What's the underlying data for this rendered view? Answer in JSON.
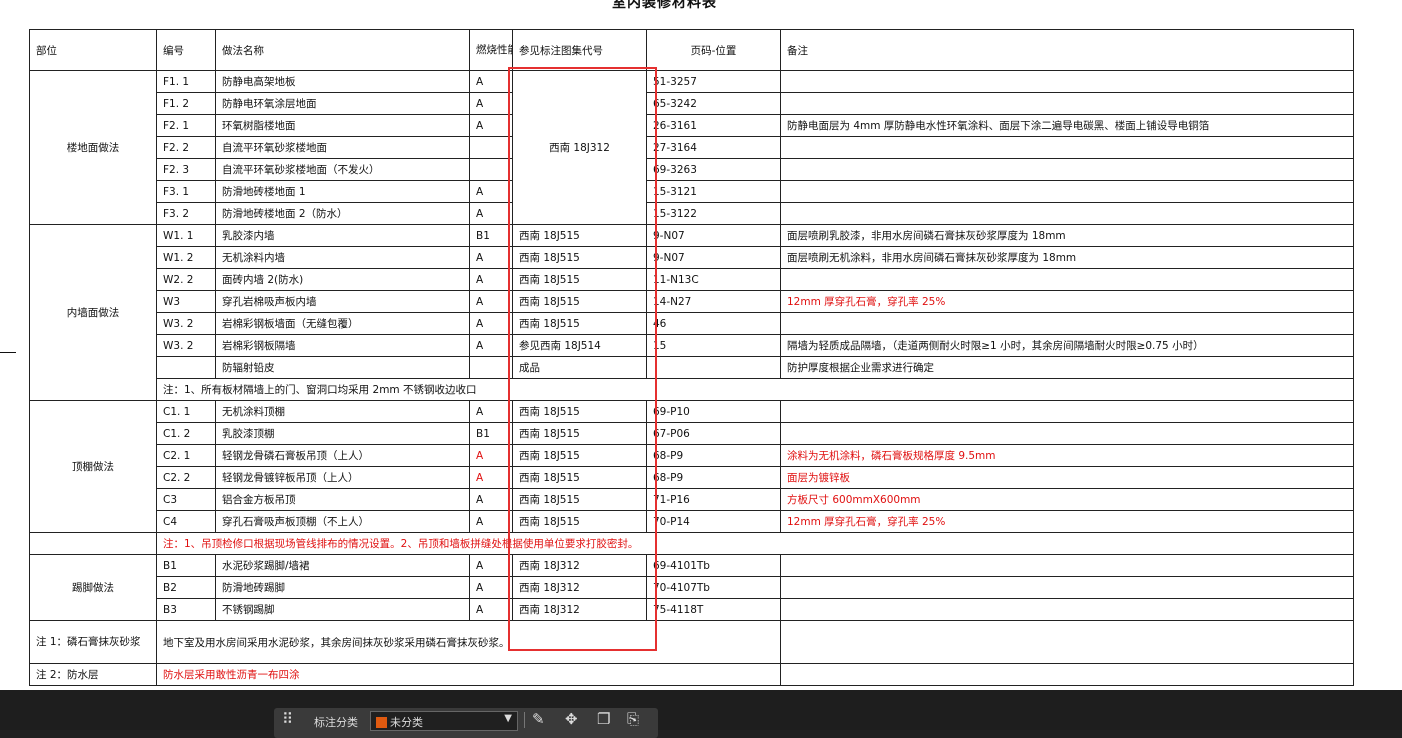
{
  "page_title": "室内装修材料表",
  "header": {
    "col_part": "部位",
    "col_code": "编号",
    "col_name": "做法名称",
    "col_fire": "燃烧性能",
    "col_atlas": "参见标注图集代号",
    "col_page": "页码-位置",
    "col_note": "备注"
  },
  "floor": {
    "part": "楼地面做法",
    "atlas_merged": "西南 18J312",
    "rows": [
      {
        "code": "F1. 1",
        "name": "防静电高架地板",
        "fire": "A",
        "page": "51-3257",
        "note": ""
      },
      {
        "code": "F1. 2",
        "name": "防静电环氧涂层地面",
        "fire": "A",
        "page": "65-3242",
        "note": ""
      },
      {
        "code": "F2. 1",
        "name": "环氧树脂楼地面",
        "fire": "A",
        "page": "26-3161",
        "note": "防静电面层为 4mm 厚防静电水性环氧涂料、面层下涂二遍导电碳黑、楼面上铺设导电铜箔"
      },
      {
        "code": "F2. 2",
        "name": "自流平环氧砂浆楼地面",
        "fire": "",
        "page": "27-3164",
        "note": ""
      },
      {
        "code": "F2. 3",
        "name": "自流平环氧砂浆楼地面（不发火）",
        "fire": "",
        "page": "69-3263",
        "note": ""
      },
      {
        "code": "F3. 1",
        "name": "防滑地砖楼地面 1",
        "fire": "A",
        "page": "15-3121",
        "note": ""
      },
      {
        "code": "F3. 2",
        "name": "防滑地砖楼地面 2（防水）",
        "fire": "A",
        "page": "15-3122",
        "note": ""
      }
    ]
  },
  "wall": {
    "part": "内墙面做法",
    "rows": [
      {
        "code": "W1. 1",
        "name": "乳胶漆内墙",
        "fire": "B1",
        "atlas": "西南 18J515",
        "page": "9-N07",
        "note": "面层喷刷乳胶漆，非用水房间磷石膏抹灰砂浆厚度为 18mm"
      },
      {
        "code": "W1. 2",
        "name": "无机涂料内墙",
        "fire": "A",
        "atlas": "西南 18J515",
        "page": "9-N07",
        "note": "面层喷刷无机涂料，非用水房间磷石膏抹灰砂浆厚度为 18mm"
      },
      {
        "code": "W2. 2",
        "name": "面砖内墙 2(防水)",
        "fire": "A",
        "atlas": "西南 18J515",
        "page": "11-N13C",
        "note": ""
      },
      {
        "code": "W3",
        "name": "穿孔岩棉吸声板内墙",
        "fire": "A",
        "atlas": "西南 18J515",
        "page": "14-N27",
        "note": "12mm 厚穿孔石膏，穿孔率 25%"
      },
      {
        "code": "W3. 2",
        "name": "岩棉彩钢板墙面（无缝包覆）",
        "fire": "A",
        "atlas": "西南 18J515",
        "page": "46",
        "note": ""
      },
      {
        "code": "W3. 2",
        "name": "岩棉彩钢板隔墙",
        "fire": "A",
        "atlas": "参见西南 18J514",
        "page": "15",
        "note": "隔墙为轻质成品隔墙，（走道两侧耐火时限≥1 小时，其余房间隔墙耐火时限≥0.75 小时）"
      },
      {
        "code": "",
        "name": "防辐射铅皮",
        "fire": "",
        "atlas": "成品",
        "page": "",
        "note": "防护厚度根据企业需求进行确定"
      }
    ],
    "footnote": "注：1、所有板材隔墙上的门、窗洞口均采用 2mm 不锈钢收边收口"
  },
  "ceiling": {
    "part": "顶棚做法",
    "rows": [
      {
        "code": "C1. 1",
        "name": "无机涂料顶棚",
        "fire": "A",
        "atlas": "西南 18J515",
        "page": "69-P10",
        "note": ""
      },
      {
        "code": "C1. 2",
        "name": "乳胶漆顶棚",
        "fire": "B1",
        "atlas": "西南 18J515",
        "page": "67-P06",
        "note": ""
      },
      {
        "code": "C2. 1",
        "name": "轻钢龙骨磷石膏板吊顶（上人）",
        "fire": "A",
        "atlas": "西南 18J515",
        "page": "68-P9",
        "note": "涂料为无机涂料，磷石膏板规格厚度 9.5mm"
      },
      {
        "code": "C2. 2",
        "name": "轻钢龙骨镀锌板吊顶（上人）",
        "fire": "A",
        "atlas": "西南 18J515",
        "page": "68-P9",
        "note": "面层为镀锌板"
      },
      {
        "code": "C3",
        "name": "铝合金方板吊顶",
        "fire": "A",
        "atlas": "西南 18J515",
        "page": "71-P16",
        "note": "方板尺寸 600mmX600mm"
      },
      {
        "code": "C4",
        "name": "穿孔石膏吸声板顶棚（不上人）",
        "fire": "A",
        "atlas": "西南 18J515",
        "page": "70-P14",
        "note": "12mm 厚穿孔石膏，穿孔率 25%"
      }
    ],
    "footnote": "注：1、吊顶检修口根据现场管线排布的情况设置。2、吊顶和墙板拼缝处根据使用单位要求打胶密封。"
  },
  "skirting": {
    "part": "踢脚做法",
    "rows": [
      {
        "code": "B1",
        "name": "水泥砂浆踢脚/墙裙",
        "fire": "A",
        "atlas": "西南 18J312",
        "page": "69-4101Tb",
        "note": ""
      },
      {
        "code": "B2",
        "name": "防滑地砖踢脚",
        "fire": "A",
        "atlas": "西南 18J312",
        "page": "70-4107Tb",
        "note": ""
      },
      {
        "code": "B3",
        "name": "不锈钢踢脚",
        "fire": "A",
        "atlas": "西南 18J312",
        "page": "75-4118T",
        "note": ""
      }
    ]
  },
  "notes": [
    {
      "label": "注 1：磷石膏抹灰砂浆",
      "text": "地下室及用水房间采用水泥砂浆，其余房间抹灰砂浆采用磷石膏抹灰砂浆。"
    },
    {
      "label": "注 2：防水层",
      "text": "防水层采用敢性沥青一布四涂"
    }
  ],
  "toolbar": {
    "label": "标注分类",
    "select_value": "未分类",
    "swatch_color": "#e05a10",
    "icons": [
      "grid-icon",
      "edit-icon",
      "move-icon",
      "copy-icon",
      "paste-icon"
    ]
  }
}
